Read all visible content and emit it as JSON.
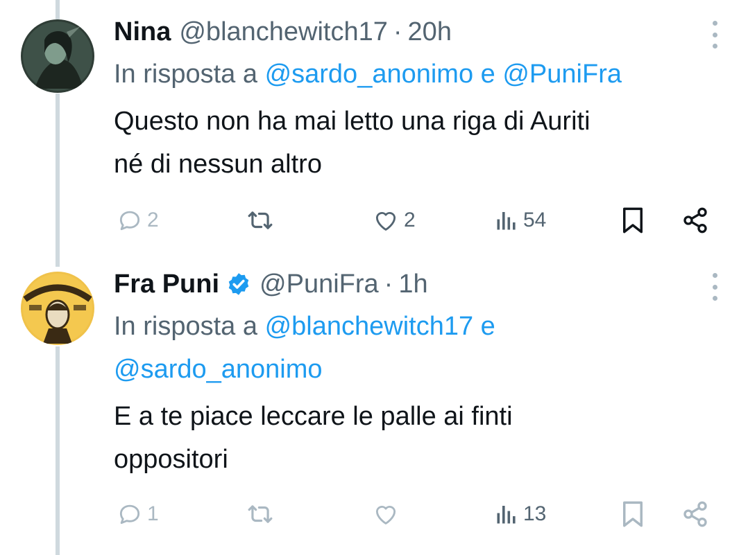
{
  "tweets": [
    {
      "name": "Nina",
      "handle": "@blanchewitch17",
      "separator": "·",
      "time": "20h",
      "verified": false,
      "reply_prefix": "In risposta a",
      "reply_mentions": [
        "@sardo_anonimo",
        "@PuniFra"
      ],
      "reply_joiner": "e",
      "text_lines": [
        "Questo non ha mai letto una riga di Auriti",
        "né di nessun altro"
      ],
      "replies": "2",
      "retweets": "",
      "likes": "2",
      "views": "54",
      "liked": false
    },
    {
      "name": "Fra Puni",
      "handle": "@PuniFra",
      "separator": "·",
      "time": "1h",
      "verified": true,
      "reply_prefix": "In risposta a",
      "reply_mentions": [
        "@blanchewitch17",
        "@sardo_anonimo"
      ],
      "reply_joiner": "e",
      "text_lines": [
        "E a te piace leccare le palle ai finti",
        "oppositori"
      ],
      "replies": "1",
      "retweets": "",
      "likes": "",
      "views": "13"
    }
  ],
  "icons": {
    "reply": "reply-icon",
    "retweet": "retweet-icon",
    "like": "heart-icon",
    "views": "views-icon",
    "bookmark": "bookmark-icon",
    "share": "share-icon",
    "more": "more-options-icon",
    "verified": "verified-badge-icon"
  },
  "colors": {
    "mention": "#1d9bf0",
    "secondary_text": "#536471",
    "thread_line": "#cfd9de",
    "verified": "#1d9bf0"
  }
}
